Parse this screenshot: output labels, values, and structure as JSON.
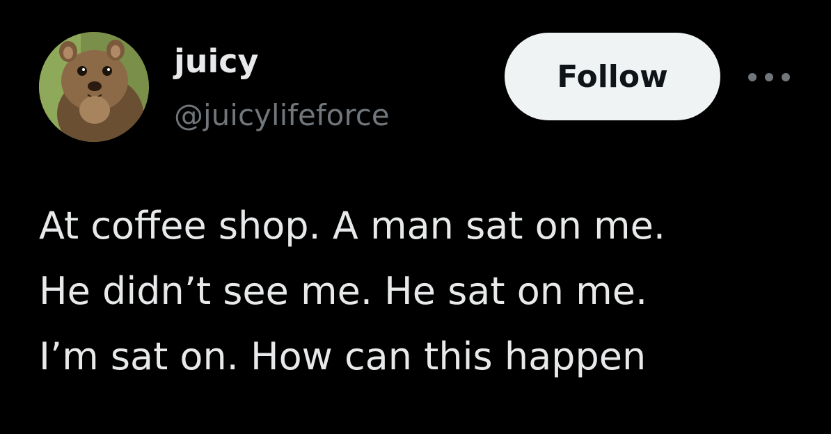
{
  "author": {
    "display_name": "juicy",
    "handle": "@juicylifeforce",
    "avatar_icon": "quokka-avatar"
  },
  "actions": {
    "follow_label": "Follow",
    "more_icon": "ellipsis-icon"
  },
  "tweet": {
    "lines": [
      "At coffee shop. A man sat on me.",
      "He didn’t see me. He sat on me.",
      "I’m sat on. How can this happen"
    ]
  },
  "colors": {
    "background": "#000000",
    "primary_text": "#e7e9ea",
    "secondary_text": "#71767b",
    "follow_button_bg": "#eff3f4",
    "follow_button_text": "#0f1419"
  }
}
